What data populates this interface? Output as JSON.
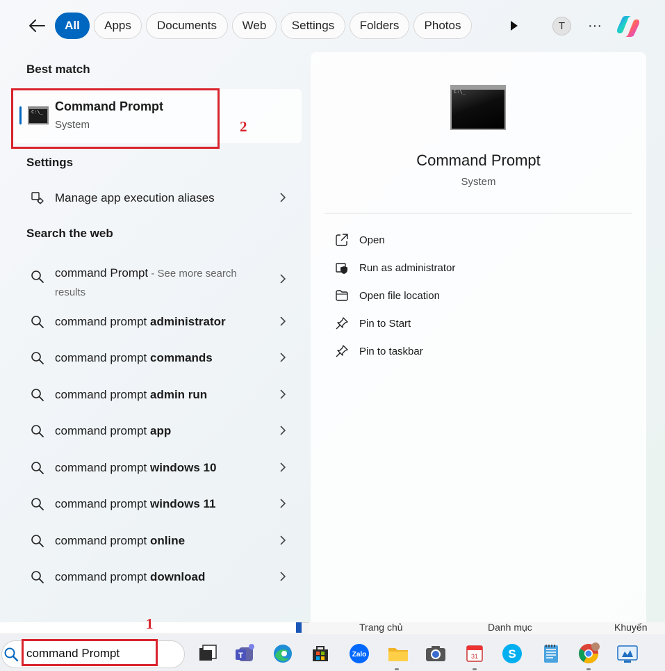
{
  "filters": {
    "tabs": [
      {
        "label": "All",
        "active": true
      },
      {
        "label": "Apps"
      },
      {
        "label": "Documents"
      },
      {
        "label": "Web"
      },
      {
        "label": "Settings"
      },
      {
        "label": "Folders"
      },
      {
        "label": "Photos"
      }
    ],
    "avatar_letter": "T",
    "more_glyph": "···"
  },
  "best_match": {
    "heading": "Best match",
    "title": "Command Prompt",
    "subtitle": "System",
    "annotation": "2"
  },
  "settings": {
    "heading": "Settings",
    "item": "Manage app execution aliases"
  },
  "web": {
    "heading": "Search the web",
    "first": {
      "query": "command Prompt",
      "hint": " - See more search results"
    },
    "suggestions": [
      {
        "prefix": "command prompt ",
        "bold": "administrator"
      },
      {
        "prefix": "command prompt ",
        "bold": "commands"
      },
      {
        "prefix": "command prompt ",
        "bold": "admin run"
      },
      {
        "prefix": "command prompt ",
        "bold": "app"
      },
      {
        "prefix": "command prompt ",
        "bold": "windows 10"
      },
      {
        "prefix": "command prompt ",
        "bold": "windows 11"
      },
      {
        "prefix": "command prompt ",
        "bold": "online"
      },
      {
        "prefix": "command prompt ",
        "bold": "download"
      }
    ]
  },
  "detail": {
    "title": "Command Prompt",
    "subtitle": "System",
    "actions": [
      {
        "label": "Open",
        "icon": "open-external-icon"
      },
      {
        "label": "Run as administrator",
        "icon": "shield-icon"
      },
      {
        "label": "Open file location",
        "icon": "folder-icon"
      },
      {
        "label": "Pin to Start",
        "icon": "pin-icon"
      },
      {
        "label": "Pin to taskbar",
        "icon": "pin-icon"
      }
    ]
  },
  "background_web": {
    "links": [
      "Trang chủ",
      "Danh mục",
      "Khuyến mãi"
    ]
  },
  "search": {
    "value": "command Prompt",
    "annotation": "1"
  },
  "taskbar": {
    "apps": [
      "task-view",
      "teams",
      "edge",
      "microsoft-store",
      "zalo",
      "file-explorer",
      "camera",
      "calendar-app",
      "skype",
      "notepad",
      "chrome",
      "remote-desktop"
    ]
  },
  "colors": {
    "accent": "#0067c0",
    "annotation_red": "#d9232d"
  }
}
